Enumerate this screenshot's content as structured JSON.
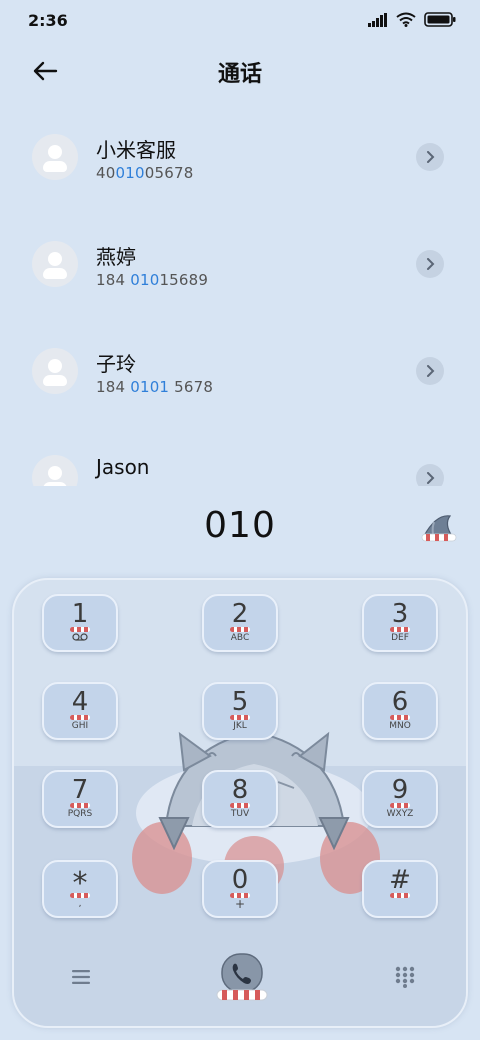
{
  "status": {
    "time": "2:36"
  },
  "header": {
    "title": "通话"
  },
  "contacts": [
    {
      "name": "小米客服",
      "number_pre": "40",
      "number_hl": "010",
      "number_post": "05678"
    },
    {
      "name": "燕婷",
      "number_pre": "184 ",
      "number_hl": "010",
      "number_post": "15689"
    },
    {
      "name": "子玲",
      "number_pre": "184 ",
      "number_hl": "0101",
      "number_post": " 5678"
    },
    {
      "name": "Jason",
      "number_pre": "",
      "number_hl": "",
      "number_post": ""
    }
  ],
  "dialed": "010",
  "keys": [
    {
      "digit": "1",
      "sub": ""
    },
    {
      "digit": "2",
      "sub": "ABC"
    },
    {
      "digit": "3",
      "sub": "DEF"
    },
    {
      "digit": "4",
      "sub": "GHI"
    },
    {
      "digit": "5",
      "sub": "JKL"
    },
    {
      "digit": "6",
      "sub": "MNO"
    },
    {
      "digit": "7",
      "sub": "PQRS"
    },
    {
      "digit": "8",
      "sub": "TUV"
    },
    {
      "digit": "9",
      "sub": "WXYZ"
    },
    {
      "digit": "*",
      "sub": ","
    },
    {
      "digit": "0",
      "sub": "+"
    },
    {
      "digit": "#",
      "sub": ""
    }
  ],
  "icons": {
    "back": "arrow-left-icon",
    "chevron": "chevron-right-icon",
    "menu": "menu-icon",
    "dialpad": "dialpad-icon",
    "call": "phone-icon",
    "voicemail": "voicemail-icon"
  },
  "colors": {
    "background": "#d7e4f3",
    "highlight": "#2f7fd9",
    "key": "#c3d4ea",
    "accent_red": "#d65b5b"
  }
}
